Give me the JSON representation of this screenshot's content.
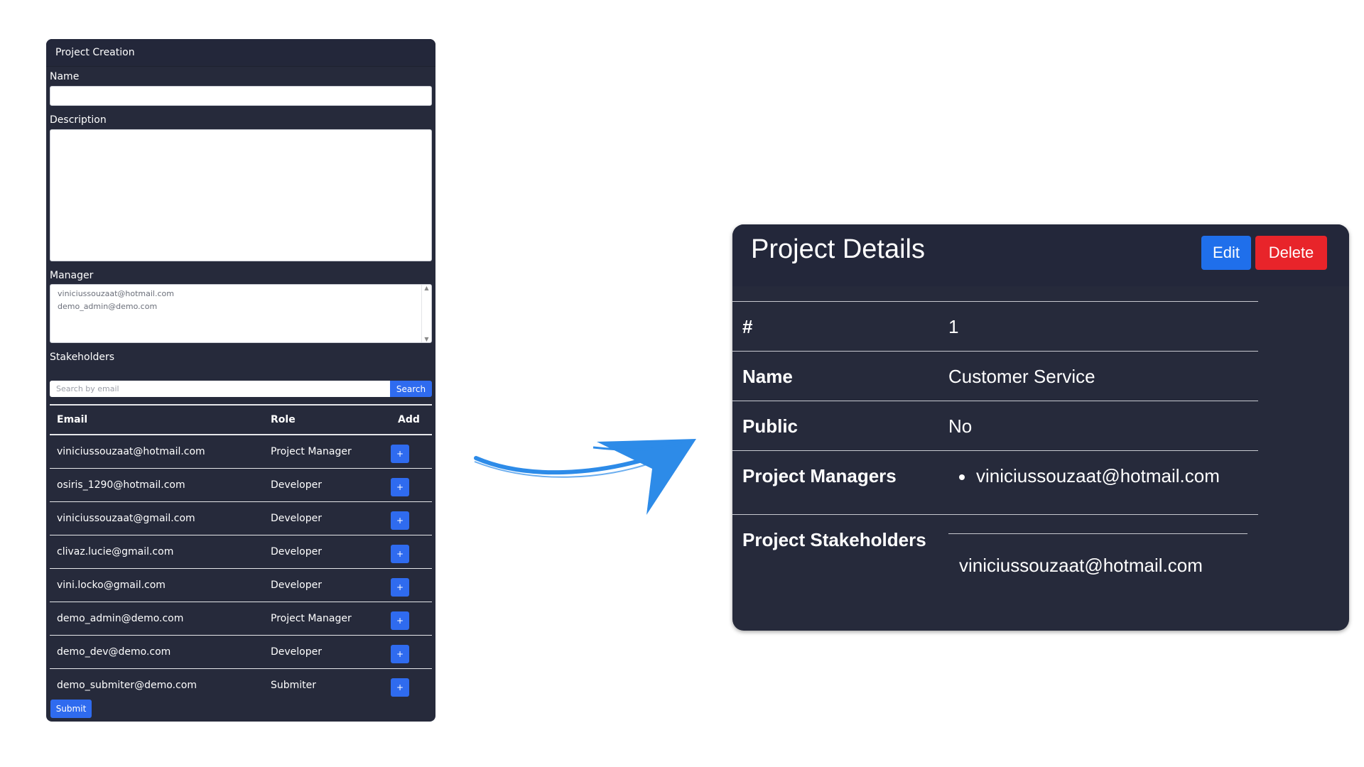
{
  "form": {
    "title": "Project Creation",
    "name_label": "Name",
    "name_value": "",
    "description_label": "Description",
    "description_value": "",
    "manager_label": "Manager",
    "manager_options": [
      "viniciussouzaat@hotmail.com",
      "demo_admin@demo.com"
    ],
    "stakeholders_label": "Stakeholders",
    "search_placeholder": "Search by email",
    "search_button": "Search",
    "columns": [
      "Email",
      "Role",
      "Add"
    ],
    "rows": [
      {
        "email": "viniciussouzaat@hotmail.com",
        "role": "Project Manager"
      },
      {
        "email": "osiris_1290@hotmail.com",
        "role": "Developer"
      },
      {
        "email": "viniciussouzaat@gmail.com",
        "role": "Developer"
      },
      {
        "email": "clivaz.lucie@gmail.com",
        "role": "Developer"
      },
      {
        "email": "vini.locko@gmail.com",
        "role": "Developer"
      },
      {
        "email": "demo_admin@demo.com",
        "role": "Project Manager"
      },
      {
        "email": "demo_dev@demo.com",
        "role": "Developer"
      },
      {
        "email": "demo_submiter@demo.com",
        "role": "Submiter"
      }
    ],
    "add_button_label": "+",
    "submit_button": "Submit"
  },
  "details": {
    "title": "Project Details",
    "edit_button": "Edit",
    "delete_button": "Delete",
    "id_label": "#",
    "id_value": "1",
    "name_label": "Name",
    "name_value": "Customer Service",
    "public_label": "Public",
    "public_value": "No",
    "managers_label": "Project Managers",
    "managers": [
      "viniciussouzaat@hotmail.com"
    ],
    "stakeholders_label": "Project Stakeholders",
    "stakeholders": [
      "viniciussouzaat@hotmail.com"
    ]
  },
  "colors": {
    "card_bg": "#262a3b",
    "primary": "#2f6bef",
    "danger": "#e8242a",
    "arrow": "#2d8be8"
  }
}
